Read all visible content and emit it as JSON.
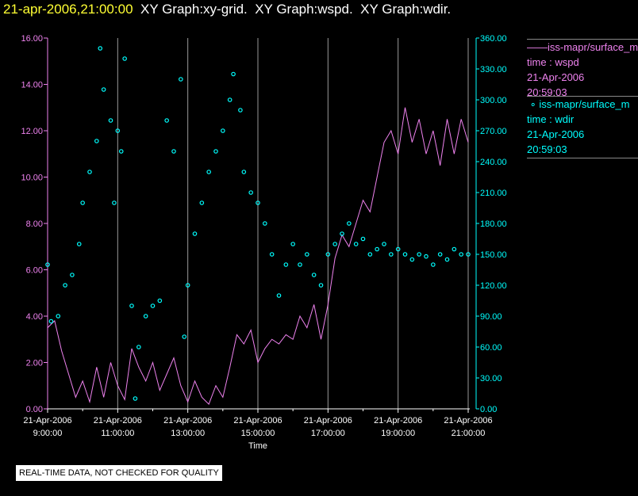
{
  "header": {
    "timestamp": "21-apr-2006,21:00:00",
    "graphs": "  XY Graph:xy-grid.  XY Graph:wspd.  XY Graph:wdir."
  },
  "legend": [
    {
      "name": "iss-mapr/surface_m",
      "field": "time : wspd",
      "date": "21-Apr-2006",
      "time": "20:59:03",
      "color": "#ee82ee"
    },
    {
      "name": "iss-mapr/surface_m",
      "field": "time : wdir",
      "date": "21-Apr-2006",
      "time": "20:59:03",
      "color": "#00ffff"
    }
  ],
  "note": "REAL-TIME DATA, NOT CHECKED FOR QUALITY",
  "chart_data": {
    "type": "line",
    "xlabel": "Time",
    "xlim": [
      9,
      21
    ],
    "xticks": [
      {
        "v": 9,
        "d": "21-Apr-2006",
        "t": "9:00:00"
      },
      {
        "v": 11,
        "d": "21-Apr-2006",
        "t": "11:00:00"
      },
      {
        "v": 13,
        "d": "21-Apr-2006",
        "t": "13:00:00"
      },
      {
        "v": 15,
        "d": "21-Apr-2006",
        "t": "15:00:00"
      },
      {
        "v": 17,
        "d": "21-Apr-2006",
        "t": "17:00:00"
      },
      {
        "v": 19,
        "d": "21-Apr-2006",
        "t": "19:00:00"
      },
      {
        "v": 21,
        "d": "21-Apr-2006",
        "t": "21:00:00"
      }
    ],
    "ylim_left": [
      0,
      16
    ],
    "yticks_left": [
      "0.00",
      "2.00",
      "4.00",
      "6.00",
      "8.00",
      "10.00",
      "12.00",
      "14.00",
      "16.00"
    ],
    "ylim_right": [
      0,
      360
    ],
    "yticks_right": [
      "0.00",
      "30.00",
      "60.00",
      "90.00",
      "120.00",
      "150.00",
      "180.00",
      "210.00",
      "240.00",
      "270.00",
      "300.00",
      "330.00",
      "360.00"
    ],
    "grid": "vertical",
    "series": [
      {
        "name": "wspd",
        "axis": "left",
        "style": "line",
        "color": "#ee82ee",
        "x": [
          9.0,
          9.2,
          9.4,
          9.6,
          9.8,
          10.0,
          10.2,
          10.4,
          10.6,
          10.8,
          11.0,
          11.2,
          11.4,
          11.6,
          11.8,
          12.0,
          12.2,
          12.4,
          12.6,
          12.8,
          13.0,
          13.2,
          13.4,
          13.6,
          13.8,
          14.0,
          14.2,
          14.4,
          14.6,
          14.8,
          15.0,
          15.2,
          15.4,
          15.6,
          15.8,
          16.0,
          16.2,
          16.4,
          16.6,
          16.8,
          17.0,
          17.2,
          17.4,
          17.6,
          17.8,
          18.0,
          18.2,
          18.4,
          18.6,
          18.8,
          19.0,
          19.2,
          19.4,
          19.6,
          19.8,
          20.0,
          20.2,
          20.4,
          20.6,
          20.8,
          21.0
        ],
        "y": [
          3.5,
          3.8,
          2.5,
          1.5,
          0.5,
          1.2,
          0.3,
          1.8,
          0.5,
          2.0,
          1.0,
          0.4,
          2.6,
          1.8,
          1.2,
          2.0,
          0.8,
          1.5,
          2.2,
          1.0,
          0.3,
          1.2,
          0.5,
          0.2,
          1.0,
          0.5,
          1.8,
          3.2,
          2.8,
          3.4,
          2.0,
          2.6,
          3.0,
          2.8,
          3.2,
          3.0,
          4.0,
          3.5,
          4.5,
          3.0,
          4.5,
          6.5,
          7.5,
          7.0,
          8.0,
          9.0,
          8.5,
          10.0,
          11.5,
          12.0,
          11.0,
          13.0,
          11.5,
          12.5,
          11.0,
          12.0,
          10.5,
          12.5,
          11.0,
          12.5,
          11.5
        ]
      },
      {
        "name": "wdir",
        "axis": "right",
        "style": "circle",
        "color": "#00ffff",
        "x": [
          9.0,
          9.1,
          9.3,
          9.5,
          9.7,
          9.9,
          10.0,
          10.2,
          10.4,
          10.5,
          10.6,
          10.8,
          10.9,
          11.0,
          11.1,
          11.2,
          11.4,
          11.5,
          11.6,
          11.8,
          12.0,
          12.2,
          12.4,
          12.6,
          12.8,
          12.9,
          13.0,
          13.2,
          13.4,
          13.6,
          13.8,
          14.0,
          14.2,
          14.3,
          14.5,
          14.6,
          14.8,
          15.0,
          15.2,
          15.4,
          15.6,
          15.8,
          16.0,
          16.2,
          16.4,
          16.6,
          16.8,
          17.0,
          17.2,
          17.4,
          17.6,
          17.8,
          18.0,
          18.2,
          18.4,
          18.6,
          18.8,
          19.0,
          19.2,
          19.4,
          19.6,
          19.8,
          20.0,
          20.2,
          20.4,
          20.6,
          20.8,
          21.0
        ],
        "y": [
          140,
          85,
          90,
          120,
          130,
          160,
          200,
          230,
          260,
          350,
          310,
          280,
          200,
          270,
          250,
          340,
          100,
          10,
          60,
          90,
          100,
          105,
          280,
          250,
          320,
          70,
          120,
          170,
          200,
          230,
          250,
          270,
          300,
          325,
          290,
          230,
          210,
          200,
          180,
          150,
          110,
          140,
          160,
          140,
          150,
          130,
          120,
          150,
          160,
          170,
          180,
          160,
          165,
          150,
          155,
          160,
          150,
          155,
          150,
          145,
          150,
          148,
          140,
          150,
          145,
          155,
          150,
          150
        ]
      }
    ]
  }
}
